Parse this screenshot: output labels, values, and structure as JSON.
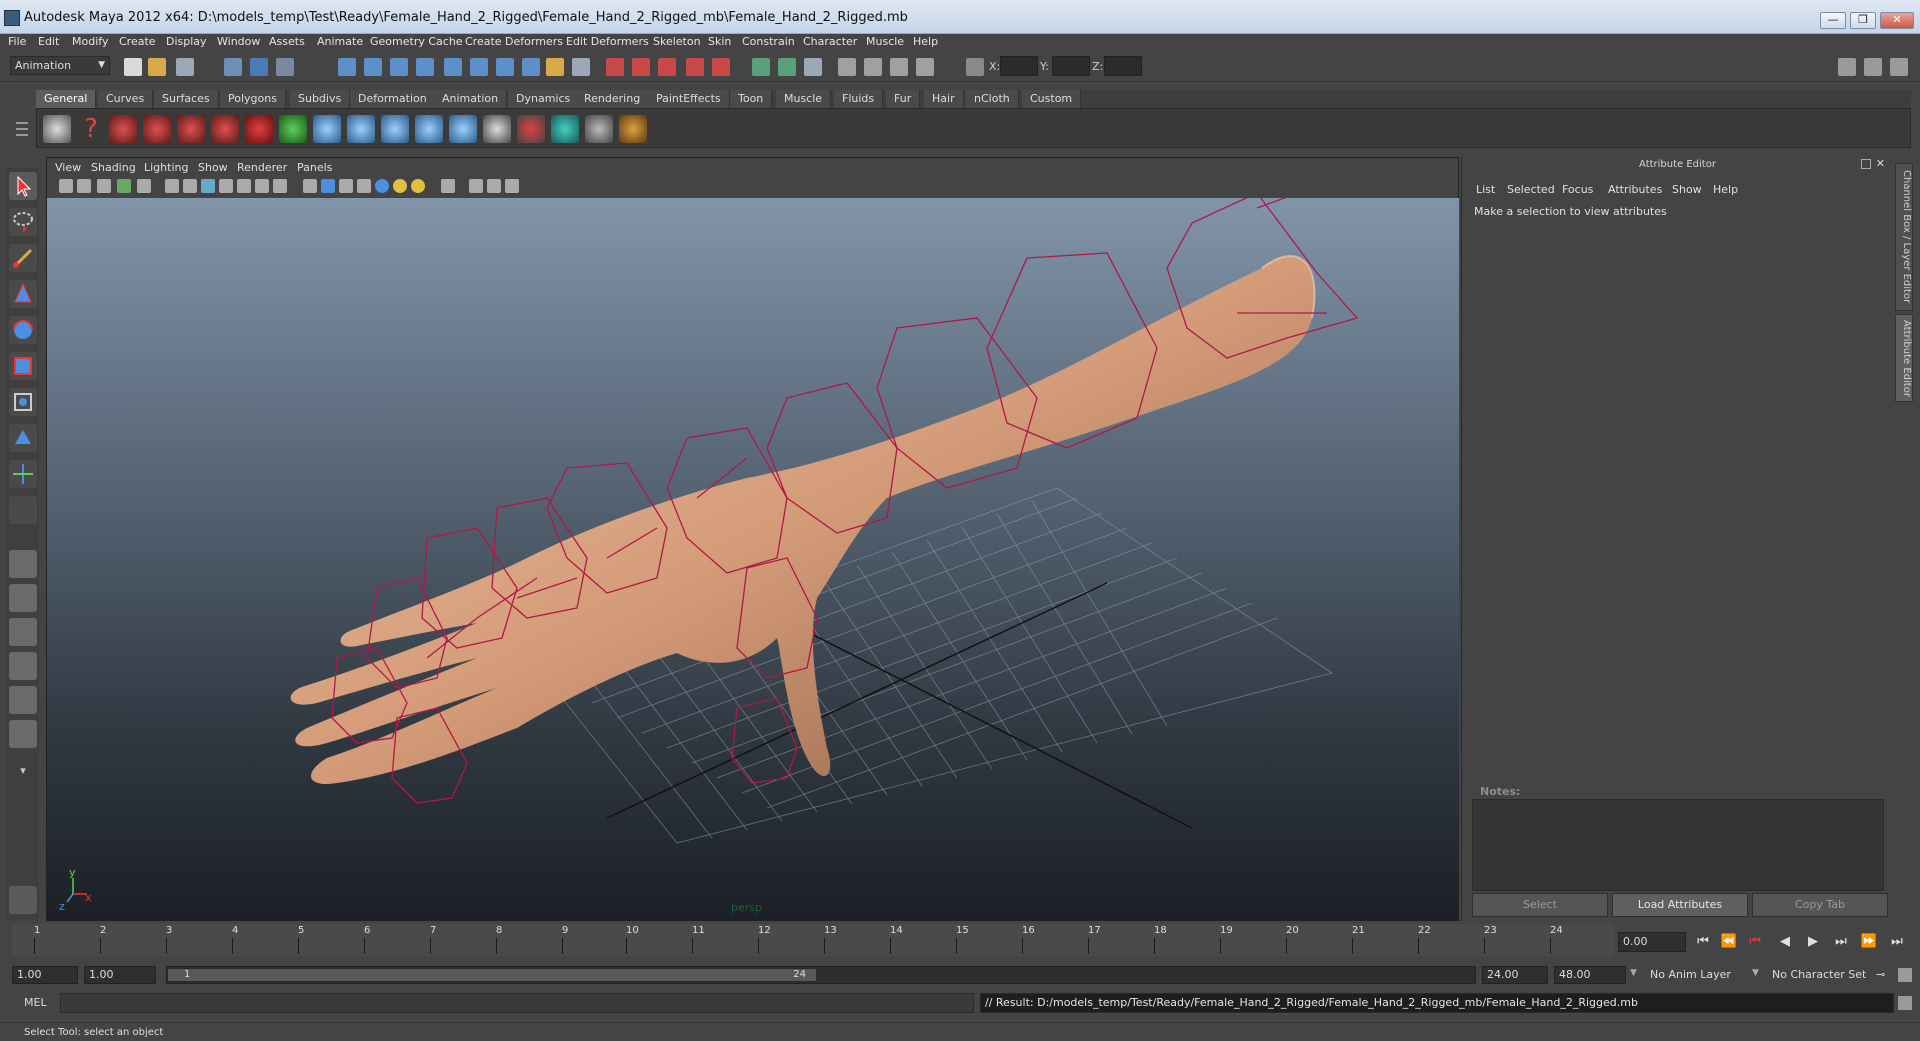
{
  "window": {
    "title": "Autodesk Maya 2012 x64: D:\\models_temp\\Test\\Ready\\Female_Hand_2_Rigged\\Female_Hand_2_Rigged_mb\\Female_Hand_2_Rigged.mb",
    "minimize": "—",
    "restore": "❐",
    "close": "✕"
  },
  "menubar": [
    "File",
    "Edit",
    "Modify",
    "Create",
    "Display",
    "Window",
    "Assets",
    "Animate",
    "Geometry Cache",
    "Create Deformers",
    "Edit Deformers",
    "Skeleton",
    "Skin",
    "Constrain",
    "Character",
    "Muscle",
    "Help"
  ],
  "statusline": {
    "menu_set": "Animation",
    "x_label": "X:",
    "y_label": "Y:",
    "z_label": "Z:"
  },
  "shelf_tabs": [
    "General",
    "Curves",
    "Surfaces",
    "Polygons",
    "Subdivs",
    "Deformation",
    "Animation",
    "Dynamics",
    "Rendering",
    "PaintEffects",
    "Toon",
    "Muscle",
    "Fluids",
    "Fur",
    "Hair",
    "nCloth",
    "Custom"
  ],
  "active_shelf_tab": "General",
  "viewport": {
    "panel_menu": [
      "View",
      "Shading",
      "Lighting",
      "Show",
      "Renderer",
      "Panels"
    ],
    "camera_label": "persp",
    "axis_x": "x",
    "axis_y": "y",
    "axis_z": "z"
  },
  "attribute_editor": {
    "title": "Attribute Editor",
    "menu": [
      "List",
      "Selected",
      "Focus",
      "Attributes",
      "Show",
      "Help"
    ],
    "message": "Make a selection to view attributes",
    "notes_label": "Notes:",
    "buttons": {
      "select": "Select",
      "load": "Load Attributes",
      "copy": "Copy Tab"
    },
    "side_tabs": [
      "Channel Box / Layer Editor",
      "Attribute Editor"
    ]
  },
  "timeslider": {
    "ticks": [
      "1",
      "2",
      "3",
      "4",
      "5",
      "6",
      "7",
      "8",
      "9",
      "10",
      "11",
      "12",
      "13",
      "14",
      "15",
      "16",
      "17",
      "18",
      "19",
      "20",
      "21",
      "22",
      "23",
      "24"
    ],
    "current_time": "0.00"
  },
  "range": {
    "start_time": "1.00",
    "playback_start": "1.00",
    "slider_start": "1",
    "slider_end": "24",
    "playback_end": "24.00",
    "end_time": "48.00",
    "anim_layer": "No Anim Layer",
    "character_set": "No Character Set"
  },
  "command_line": {
    "mel_label": "MEL",
    "result": "// Result: D:/models_temp/Test/Ready/Female_Hand_2_Rigged/Female_Hand_2_Rigged_mb/Female_Hand_2_Rigged.mb"
  },
  "help_line": "Select Tool: select an object"
}
